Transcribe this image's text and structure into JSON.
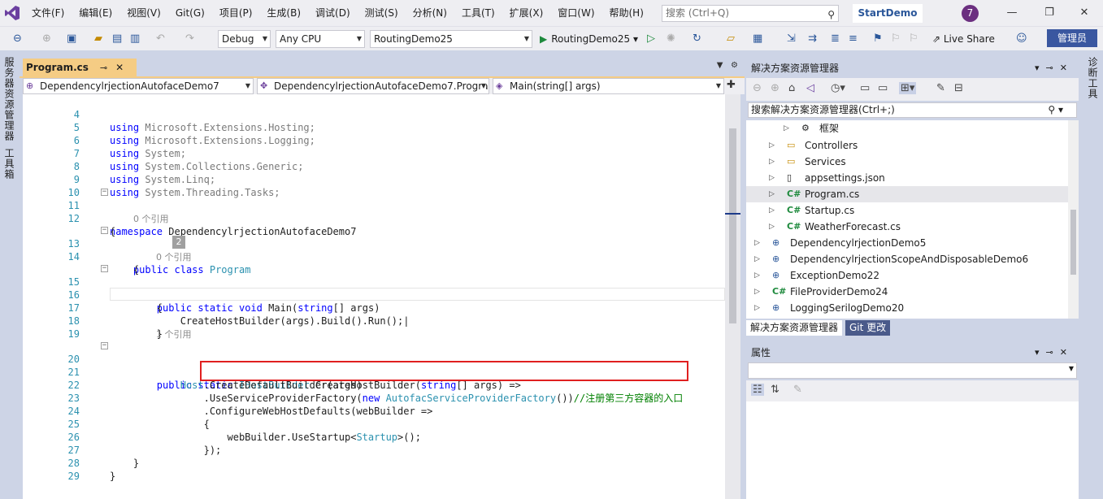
{
  "menubar": {
    "items": [
      "文件(F)",
      "编辑(E)",
      "视图(V)",
      "Git(G)",
      "项目(P)",
      "生成(B)",
      "调试(D)",
      "测试(S)",
      "分析(N)",
      "工具(T)",
      "扩展(X)",
      "窗口(W)",
      "帮助(H)"
    ],
    "search_placeholder": "搜索 (Ctrl+Q)",
    "solution_name": "StartDemo",
    "avatar_letter": "7"
  },
  "toolbar": {
    "config": "Debug",
    "platform": "Any CPU",
    "startup_project": "RoutingDemo25",
    "run_label": "RoutingDemo25",
    "live_share": "Live Share",
    "admin": "管理员"
  },
  "left_rail": {
    "tab1": "服务器资源管理器",
    "tab2": "工具箱"
  },
  "right_rail": {
    "tab1": "诊断工具"
  },
  "document": {
    "tab_name": "Program.cs",
    "nav_project": "DependencylrjectionAutofaceDemo7",
    "nav_class": "DependencylrjectionAutofaceDemo7.Progra",
    "nav_member": "Main(string[] args)"
  },
  "editor": {
    "codelens_0_refs": "0 个引用",
    "codelens_1_ref": "1 个引用",
    "badge": "2",
    "lines": {
      "l4": {
        "n": "4",
        "kw": "using",
        "rest": " Microsoft.Extensions.Hosting;"
      },
      "l5": {
        "n": "5",
        "kw": "using",
        "rest": " Microsoft.Extensions.Logging;"
      },
      "l6": {
        "n": "6",
        "kw": "using",
        "rest": " System;"
      },
      "l7": {
        "n": "7",
        "kw": "using",
        "rest": " System.Collections.Generic;"
      },
      "l8": {
        "n": "8",
        "kw": "using",
        "rest": " System.Linq;"
      },
      "l9": {
        "n": "9",
        "kw": "using",
        "rest": " System.Threading.Tasks;"
      },
      "l10": {
        "n": "10"
      },
      "l11": {
        "n": "11",
        "kw": "namespace",
        "rest": " DependencylrjectionAutofaceDemo7"
      },
      "l12": {
        "n": "12",
        "rest": "{"
      },
      "l13": {
        "n": "13",
        "kw": "public",
        "kw2": "class",
        "ty": "Program"
      },
      "l14": {
        "n": "14",
        "rest": "{"
      },
      "l15": {
        "n": "15",
        "kw": "public",
        "kw2": "static",
        "kw3": "void",
        "name": "Main",
        "p1": "(",
        "kw4": "string",
        "p2": "[] args)"
      },
      "l16": {
        "n": "16",
        "rest": "{"
      },
      "l17": {
        "n": "17",
        "rest": "CreateHostBuilder(args).Build().Run();"
      },
      "l18": {
        "n": "18",
        "rest": "}"
      },
      "l19": {
        "n": "19"
      },
      "l20": {
        "n": "20",
        "kw": "public",
        "kw2": "static",
        "ty": "IHostBuilder",
        "name": " CreateHostBuilder(",
        "kw4": "string",
        "p2": "[] args) =>"
      },
      "l21": {
        "n": "21",
        "ty": "Host",
        "rest": ".CreateDefaultBuilder(args)"
      },
      "l22": {
        "n": "22",
        "rest": ".UseServiceProviderFactory(",
        "kw": "new",
        "ty": " AutofacServiceProviderFactory",
        "p2": "())",
        "cm": "//注册第三方容器的入口"
      },
      "l23": {
        "n": "23",
        "rest": ".ConfigureWebHostDefaults(webBuilder =>"
      },
      "l24": {
        "n": "24",
        "rest": "{"
      },
      "l25": {
        "n": "25",
        "rest": "webBuilder.UseStartup<",
        "ty": "Startup",
        "p2": ">();"
      },
      "l26": {
        "n": "26",
        "rest": "});"
      },
      "l27": {
        "n": "27",
        "rest": "}"
      },
      "l28": {
        "n": "28",
        "rest": "}"
      },
      "l29": {
        "n": "29"
      }
    }
  },
  "solution_explorer": {
    "title": "解决方案资源管理器",
    "search_placeholder": "搜索解决方案资源管理器(Ctrl+;)",
    "items": [
      {
        "label": "框架",
        "icon": "⚙"
      },
      {
        "label": "Controllers",
        "icon": "folder"
      },
      {
        "label": "Services",
        "icon": "folder"
      },
      {
        "label": "appsettings.json",
        "icon": "json"
      },
      {
        "label": "Program.cs",
        "icon": "C#"
      },
      {
        "label": "Startup.cs",
        "icon": "C#"
      },
      {
        "label": "WeatherForecast.cs",
        "icon": "C#"
      },
      {
        "label": "DependencylrjectionDemo5",
        "icon": "web"
      },
      {
        "label": "DependencylrjectionScopeAndDisposableDemo6",
        "icon": "web"
      },
      {
        "label": "ExceptionDemo22",
        "icon": "web"
      },
      {
        "label": "FileProviderDemo24",
        "icon": "C#"
      },
      {
        "label": "LoggingSerilogDemo20",
        "icon": "web"
      }
    ],
    "tab_active": "解决方案资源管理器",
    "tab_inactive": "Git 更改"
  },
  "properties": {
    "title": "属性"
  },
  "colors": {
    "accent": "#2b579a",
    "keyword": "#0000ff",
    "type": "#2b91af",
    "comment": "#008000",
    "highlight_box": "#e02020",
    "tab_active": "#f5cc84"
  }
}
